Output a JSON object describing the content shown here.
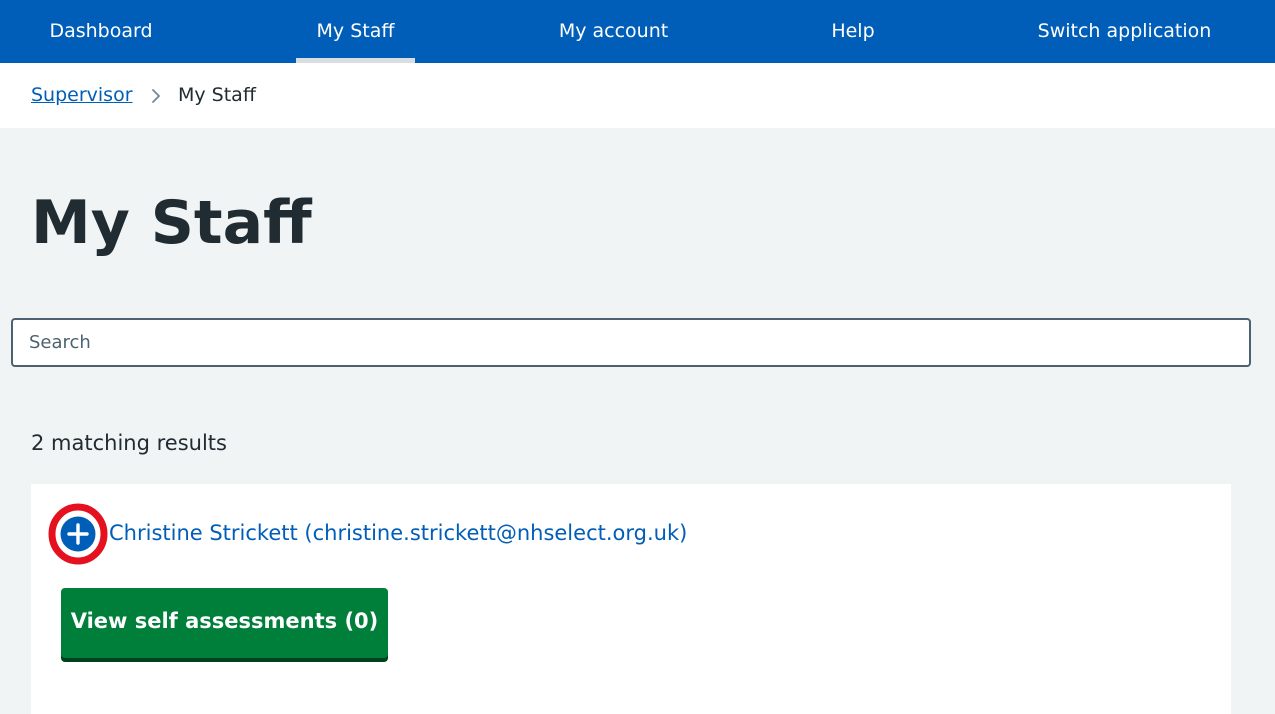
{
  "nav": {
    "items": [
      {
        "label": "Dashboard"
      },
      {
        "label": "My Staff",
        "active": true
      },
      {
        "label": "My account"
      },
      {
        "label": "Help"
      },
      {
        "label": "Switch application"
      }
    ]
  },
  "breadcrumb": {
    "parent": "Supervisor",
    "separator_icon": "chevron-right-icon",
    "current": "My Staff"
  },
  "page": {
    "title": "My Staff"
  },
  "search": {
    "placeholder": "Search",
    "value": ""
  },
  "results": {
    "count_text": "2 matching results"
  },
  "staff": [
    {
      "name": "Christine Strickett (christine.strickett@nhselect.org.uk)",
      "expand_icon": "plus-circle-icon",
      "view_button_label": "View self assessments (0)"
    }
  ],
  "colors": {
    "brand_blue": "#005eb8",
    "page_background": "#f0f4f5",
    "button_green": "#007f3b",
    "highlight_ring": "#e4121e",
    "text_dark": "#212b32"
  }
}
